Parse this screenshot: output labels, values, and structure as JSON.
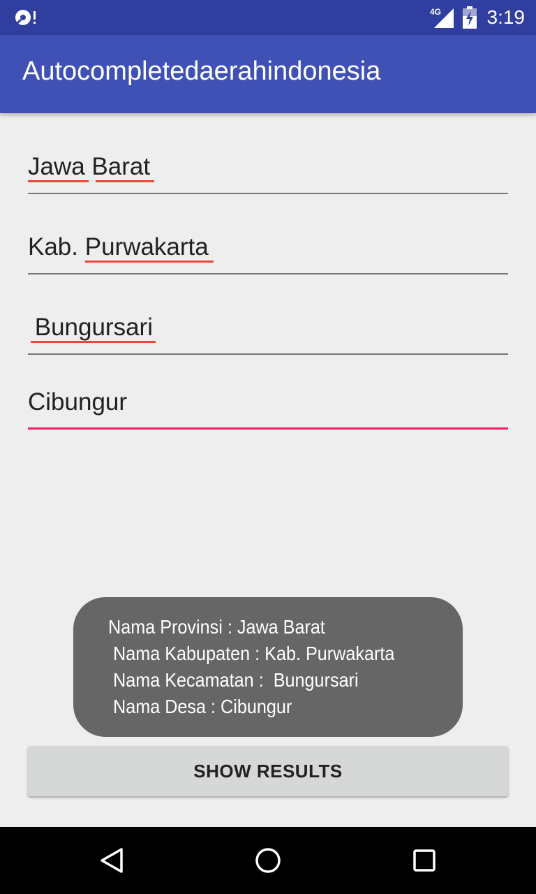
{
  "status_bar": {
    "network_label": "4G",
    "time": "3:19",
    "icons": [
      "app-notification-icon",
      "signal-icon",
      "battery-icon"
    ]
  },
  "app_bar": {
    "title": "Autocompletedaerahindonesia",
    "color": "#3f51b5",
    "status_color": "#303f9f"
  },
  "form": {
    "provinsi": "Jawa Barat",
    "kabupaten": "Kab. Purwakarta",
    "kecamatan": " Bungursari",
    "desa": "Cibungur"
  },
  "toast": {
    "lines": [
      "Nama Provinsi : Jawa Barat",
      " Nama Kabupaten : Kab. Purwakarta",
      " Nama Kecamatan :  Bungursari",
      " Nama Desa : Cibungur"
    ]
  },
  "button": {
    "label": "SHOW RESULTS"
  },
  "nav": {
    "icons": [
      "back-icon",
      "home-icon",
      "recents-icon"
    ]
  },
  "colors": {
    "accent": "#e91e63",
    "spellcheck": "#f44336"
  }
}
